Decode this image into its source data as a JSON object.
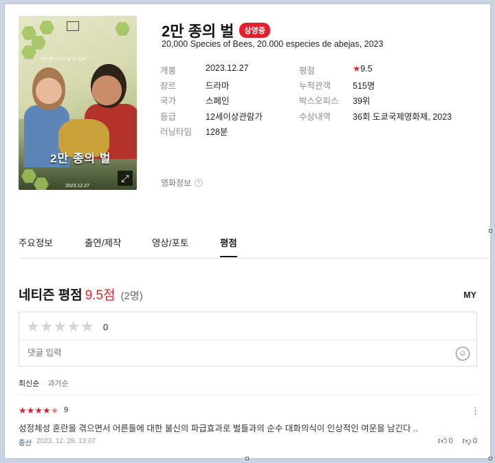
{
  "movie": {
    "title": "2만 종의 벌",
    "status_badge": "상영중",
    "subtitle": "20,000 Species of Bees, 20.000 especies de abejas, 2023",
    "poster": {
      "tagline": "\"한번쯤 누구든 될 수 있어\"",
      "title": "2만 종의 벌",
      "date": "2023.12.27"
    },
    "info_left": [
      {
        "key": "개봉",
        "value": "2023.12.27"
      },
      {
        "key": "장르",
        "value": "드라마"
      },
      {
        "key": "국가",
        "value": "스페인"
      },
      {
        "key": "등급",
        "value": "12세이상관람가"
      },
      {
        "key": "러닝타임",
        "value": "128분"
      }
    ],
    "info_right": [
      {
        "key": "평점",
        "value": "9.5"
      },
      {
        "key": "누적관객",
        "value": "515명"
      },
      {
        "key": "박스오피스",
        "value": "39위"
      },
      {
        "key": "수상내역",
        "value": "36회 도쿄국제영화제, 2023"
      }
    ],
    "movie_info_label": "영화정보",
    "colors": {
      "accent": "#e4202d",
      "link": "#1b5bb5"
    }
  },
  "tabs": [
    {
      "label": "주요정보",
      "active": false
    },
    {
      "label": "출연/제작",
      "active": false
    },
    {
      "label": "영상/포토",
      "active": false
    },
    {
      "label": "평점",
      "active": true
    }
  ],
  "reviews": {
    "heading": "네티즌 평점",
    "score": "9.5점",
    "count": "(2명)",
    "my_label": "MY",
    "rating_input_value": "0",
    "comment_placeholder": "댓글 입력",
    "sort_options": [
      "최신순",
      "과거순"
    ],
    "items": [
      {
        "rating": "9",
        "text": "성정체성 혼란을 겪으면서 어른들에 대한 불신의  파급효과로 벌들과의 순수 대화의식이 인상적인 여운을 남긴다 ..",
        "user": "중산",
        "date": "2023. 12. 28. 13:07",
        "likes": "0",
        "dislikes": "0"
      }
    ]
  }
}
